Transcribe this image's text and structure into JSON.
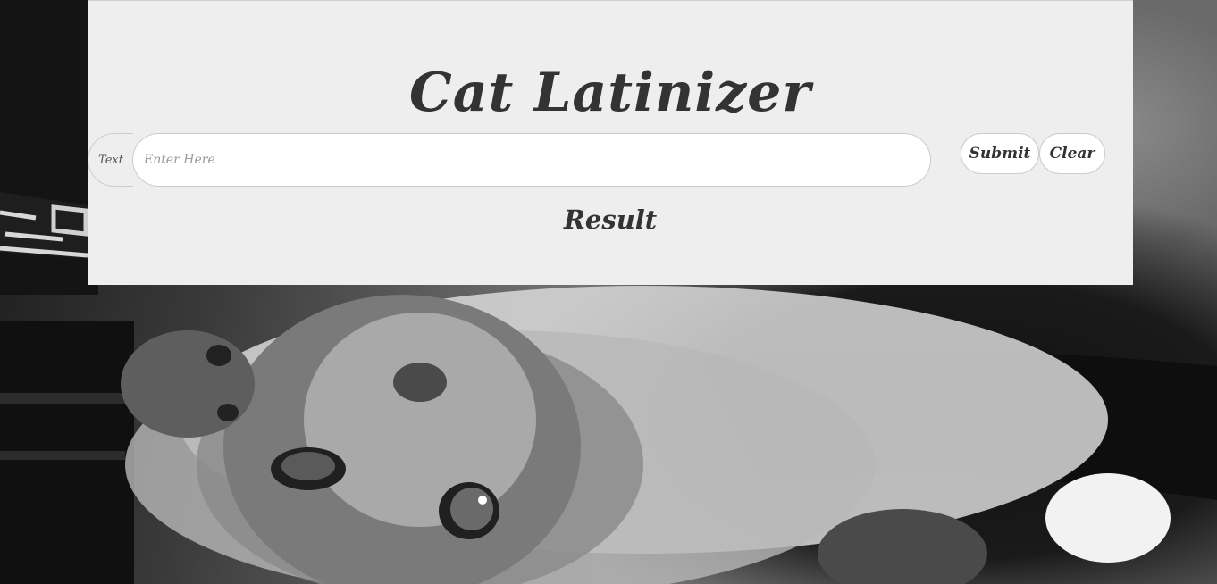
{
  "page": {
    "background_image": "grayscale-kitten-photo"
  },
  "card": {
    "title": "Cat Latinizer",
    "input_addon_label": "Text",
    "input_placeholder": "Enter Here",
    "input_value": "",
    "submit_label": "Submit",
    "clear_label": "Clear",
    "result_label": "Result"
  },
  "colors": {
    "card_background": "#eeeeee",
    "text": "#333333",
    "border": "#cccccc"
  }
}
